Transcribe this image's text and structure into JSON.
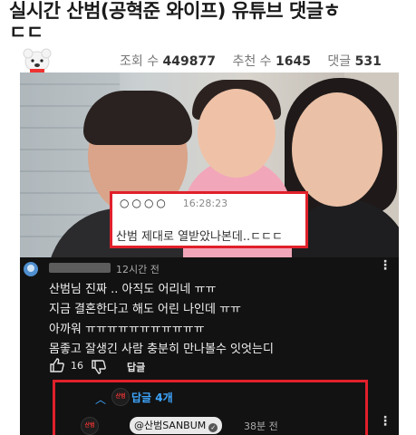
{
  "post": {
    "title_line1": "실시간 산범(공혁준 와이프) 유튜브 댓글ㅎ",
    "title_line2": "ㄷㄷ",
    "views_label": "조회 수",
    "views": "449877",
    "recommend_label": "추천 수",
    "recommend": "1645",
    "comments_label": "댓글",
    "comments": "531"
  },
  "overlay": {
    "name_dots": "○○○○",
    "time": "16:28:23",
    "message": "산범 제대로 열받았나본데..ㄷㄷㄷ"
  },
  "comment": {
    "time": "12시간 전",
    "lines": [
      "산범님 진짜 .. 아직도 어리네 ㅠㅠ",
      "지금 결혼한다고 해도 어린 나인데 ㅠㅠ",
      "아까워 ㅠㅠㅠㅠㅠㅠㅠㅠㅠㅠㅠ",
      "몸좋고 잘생긴 사람 충분히 만나볼수 잇엇는디"
    ],
    "like_count": "16",
    "reply_label": "답글",
    "replies_toggle": "답글 4개",
    "avatar_text": "산범"
  },
  "reply": {
    "author": "@산범SANBUM",
    "verified_mark": "✓",
    "time": "38분 전"
  },
  "colors": {
    "highlight": "#e0202a",
    "link_blue": "#3ea6ff",
    "dark_panel": "#121212"
  }
}
